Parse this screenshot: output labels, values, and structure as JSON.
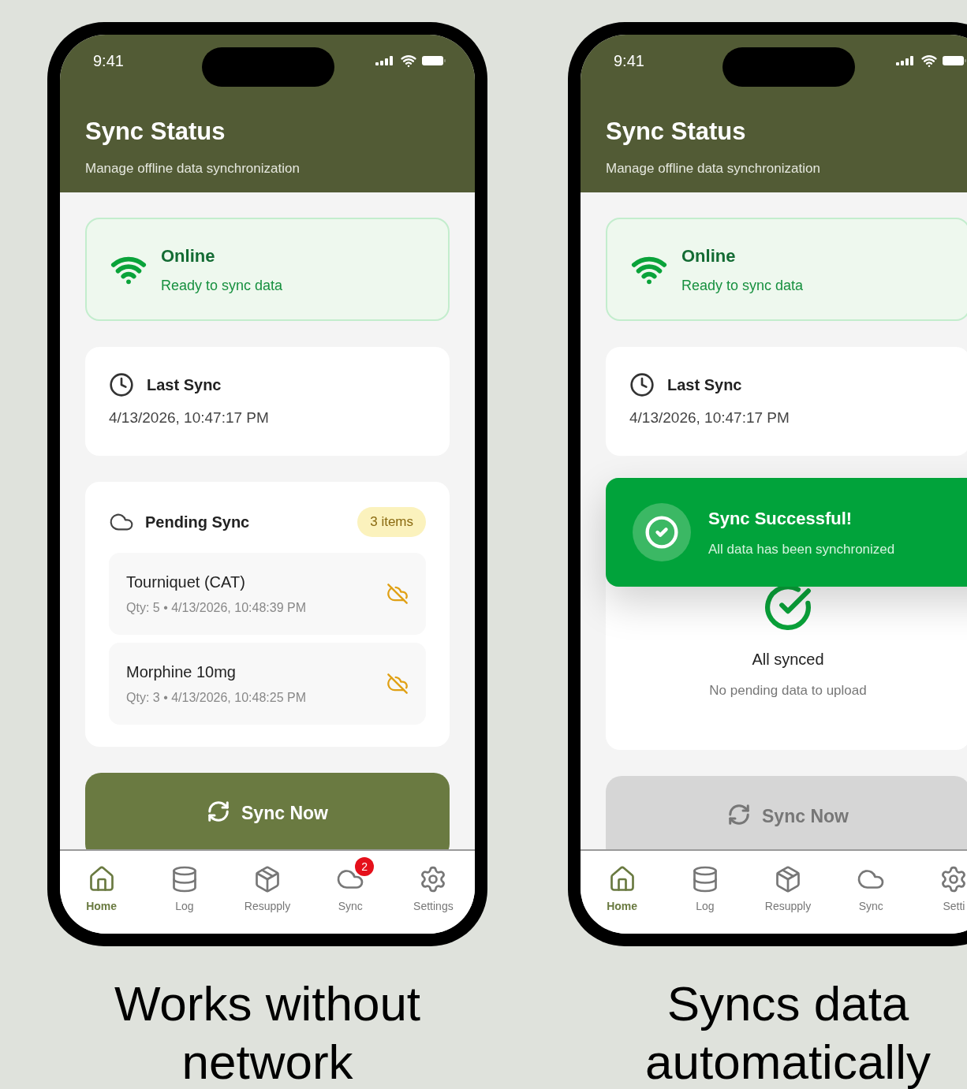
{
  "phones": [
    {
      "status_bar": {
        "time": "9:41"
      },
      "header": {
        "title": "Sync Status",
        "subtitle": "Manage offline data synchronization"
      },
      "connection": {
        "status": "Online",
        "detail": "Ready to sync data"
      },
      "last_sync": {
        "label": "Last Sync",
        "time": "4/13/2026, 10:47:17 PM"
      },
      "pending": {
        "kind": "list",
        "title": "Pending Sync",
        "count": "3 items",
        "items": [
          {
            "name": "Tourniquet (CAT)",
            "detail": "Qty: 5 • 4/13/2026, 10:48:39 PM"
          },
          {
            "name": "Morphine 10mg",
            "detail": "Qty: 3 • 4/13/2026, 10:48:25 PM"
          }
        ]
      },
      "sync_button": {
        "label": "Sync Now",
        "disabled": false
      },
      "nav": [
        {
          "label": "Home",
          "selected": true
        },
        {
          "label": "Log",
          "selected": false
        },
        {
          "label": "Resupply",
          "selected": false
        },
        {
          "label": "Sync",
          "selected": false,
          "badge": "2"
        },
        {
          "label": "Settings",
          "selected": false
        }
      ],
      "caption": "Works without network"
    },
    {
      "status_bar": {
        "time": "9:41"
      },
      "header": {
        "title": "Sync Status",
        "subtitle": "Manage offline data synchronization"
      },
      "connection": {
        "status": "Online",
        "detail": "Ready to sync data"
      },
      "last_sync": {
        "label": "Last Sync",
        "time": "4/13/2026, 10:47:17 PM"
      },
      "toast": {
        "title": "Sync Successful!",
        "message": "All data has been synchronized"
      },
      "pending": {
        "kind": "empty",
        "title": "All synced",
        "message": "No pending data to upload"
      },
      "sync_button": {
        "label": "Sync Now",
        "disabled": true
      },
      "nav": [
        {
          "label": "Home",
          "selected": true
        },
        {
          "label": "Log",
          "selected": false
        },
        {
          "label": "Resupply",
          "selected": false
        },
        {
          "label": "Sync",
          "selected": false
        },
        {
          "label": "Setti",
          "selected": false
        }
      ],
      "caption": "Syncs data automatically"
    }
  ]
}
